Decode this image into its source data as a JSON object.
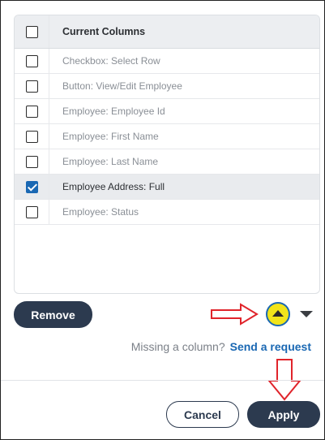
{
  "grid": {
    "header": "Current Columns",
    "rows": [
      {
        "label": "Checkbox: Select Row",
        "checked": false
      },
      {
        "label": "Button: View/Edit Employee",
        "checked": false
      },
      {
        "label": "Employee: Employee Id",
        "checked": false
      },
      {
        "label": "Employee: First Name",
        "checked": false
      },
      {
        "label": "Employee: Last Name",
        "checked": false
      },
      {
        "label": "Employee Address: Full",
        "checked": true
      },
      {
        "label": "Employee: Status",
        "checked": false
      }
    ]
  },
  "actions": {
    "remove_label": "Remove",
    "move_up_icon": "triangle-up-icon",
    "move_down_icon": "triangle-down-icon"
  },
  "footer_note": {
    "text": "Missing a column?",
    "link": "Send a request"
  },
  "dialog_buttons": {
    "cancel_label": "Cancel",
    "apply_label": "Apply"
  },
  "annotation_color": "#e0242b",
  "colors": {
    "accent": "#1a68b3",
    "dark_button": "#2c3a4f",
    "highlight": "#f1e41a"
  }
}
